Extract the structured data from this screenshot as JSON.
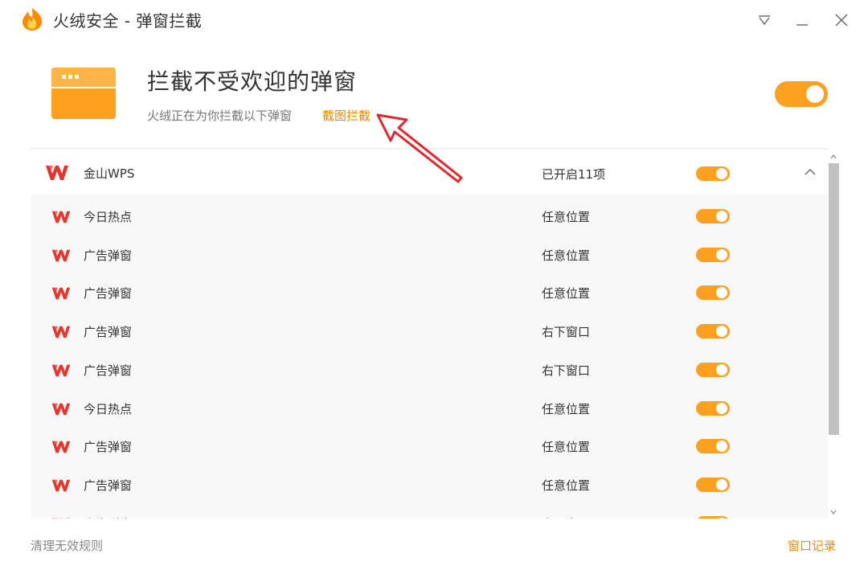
{
  "window": {
    "title": "火绒安全 - 弹窗拦截"
  },
  "header": {
    "title": "拦截不受欢迎的弹窗",
    "subtitle": "火绒正在为你拦截以下弹窗",
    "link": "截图拦截",
    "toggle_on": true
  },
  "group": {
    "name": "金山WPS",
    "status": "已开启11项",
    "toggle_on": true,
    "icon": "wps-icon",
    "expanded": true
  },
  "rows": [
    {
      "name": "今日热点",
      "status": "任意位置",
      "toggle_on": true
    },
    {
      "name": "广告弹窗",
      "status": "任意位置",
      "toggle_on": true
    },
    {
      "name": "广告弹窗",
      "status": "任意位置",
      "toggle_on": true
    },
    {
      "name": "广告弹窗",
      "status": "右下窗口",
      "toggle_on": true
    },
    {
      "name": "广告弹窗",
      "status": "右下窗口",
      "toggle_on": true
    },
    {
      "name": "今日热点",
      "status": "任意位置",
      "toggle_on": true
    },
    {
      "name": "广告弹窗",
      "status": "任意位置",
      "toggle_on": true
    },
    {
      "name": "广告弹窗",
      "status": "任意位置",
      "toggle_on": true
    },
    {
      "name": "广告弹窗",
      "status": "右下窗口",
      "toggle_on": true
    }
  ],
  "footer": {
    "left": "清理无效规则",
    "right": "窗口记录"
  },
  "colors": {
    "accent": "#ffa11f",
    "link": "#f08c00",
    "wps_red": "#e8342a",
    "annotation_arrow": "#e0282e"
  }
}
